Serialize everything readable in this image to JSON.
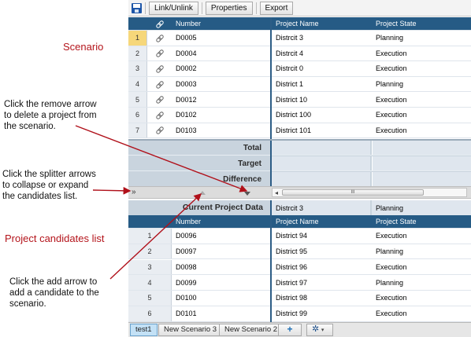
{
  "toolbar": {
    "save_icon": "save-icon",
    "buttons": [
      "Link/Unlink",
      "Properties",
      "Export"
    ]
  },
  "annotations": {
    "scenario": "Scenario",
    "remove_arrow": [
      "Click the remove arrow",
      "to delete a project from",
      "the scenario."
    ],
    "splitter": [
      "Click the splitter arrows",
      "to collapse or expand",
      "the candidates list."
    ],
    "candidates": "Project candidates list",
    "add_arrow": [
      "Click the add arrow to",
      "add a candidate to the",
      "scenario."
    ]
  },
  "scenario_grid": {
    "headers": [
      "Number",
      "Project Name",
      "Project State"
    ],
    "rows": [
      {
        "num": "1",
        "number": "D0005",
        "name": "Distrcit 3",
        "state": "Planning"
      },
      {
        "num": "2",
        "number": "D0004",
        "name": "Distrcit 4",
        "state": "Execution"
      },
      {
        "num": "3",
        "number": "D0002",
        "name": "Distrcit 0",
        "state": "Execution"
      },
      {
        "num": "4",
        "number": "D0003",
        "name": "District 1",
        "state": "Planning"
      },
      {
        "num": "5",
        "number": "D0012",
        "name": "District 10",
        "state": "Execution"
      },
      {
        "num": "6",
        "number": "D0102",
        "name": "District 100",
        "state": "Execution"
      },
      {
        "num": "7",
        "number": "D0103",
        "name": "District 101",
        "state": "Execution"
      }
    ]
  },
  "summary": {
    "total": "Total",
    "target": "Target",
    "difference": "Difference"
  },
  "splitter": {
    "scroll_thumb_grip": "III"
  },
  "current": {
    "label": "Current Project Data",
    "name": "Distrcit 3",
    "state": "Planning"
  },
  "candidates_grid": {
    "headers": [
      "Number",
      "Project Name",
      "Project State"
    ],
    "rows": [
      {
        "num": "1",
        "number": "D0096",
        "name": "District 94",
        "state": "Execution"
      },
      {
        "num": "2",
        "number": "D0097",
        "name": "District 95",
        "state": "Planning"
      },
      {
        "num": "3",
        "number": "D0098",
        "name": "District 96",
        "state": "Execution"
      },
      {
        "num": "4",
        "number": "D0099",
        "name": "District 97",
        "state": "Planning"
      },
      {
        "num": "5",
        "number": "D0100",
        "name": "District 98",
        "state": "Execution"
      },
      {
        "num": "6",
        "number": "D0101",
        "name": "District 99",
        "state": "Execution"
      }
    ]
  },
  "tabs": [
    "test1",
    "New Scenario 3",
    "New Scenario 2"
  ],
  "colors": {
    "header": "#265b85",
    "selected_row": "#f6d77a",
    "annotation_red": "#b4141b",
    "arrow_red": "#b0101a"
  }
}
